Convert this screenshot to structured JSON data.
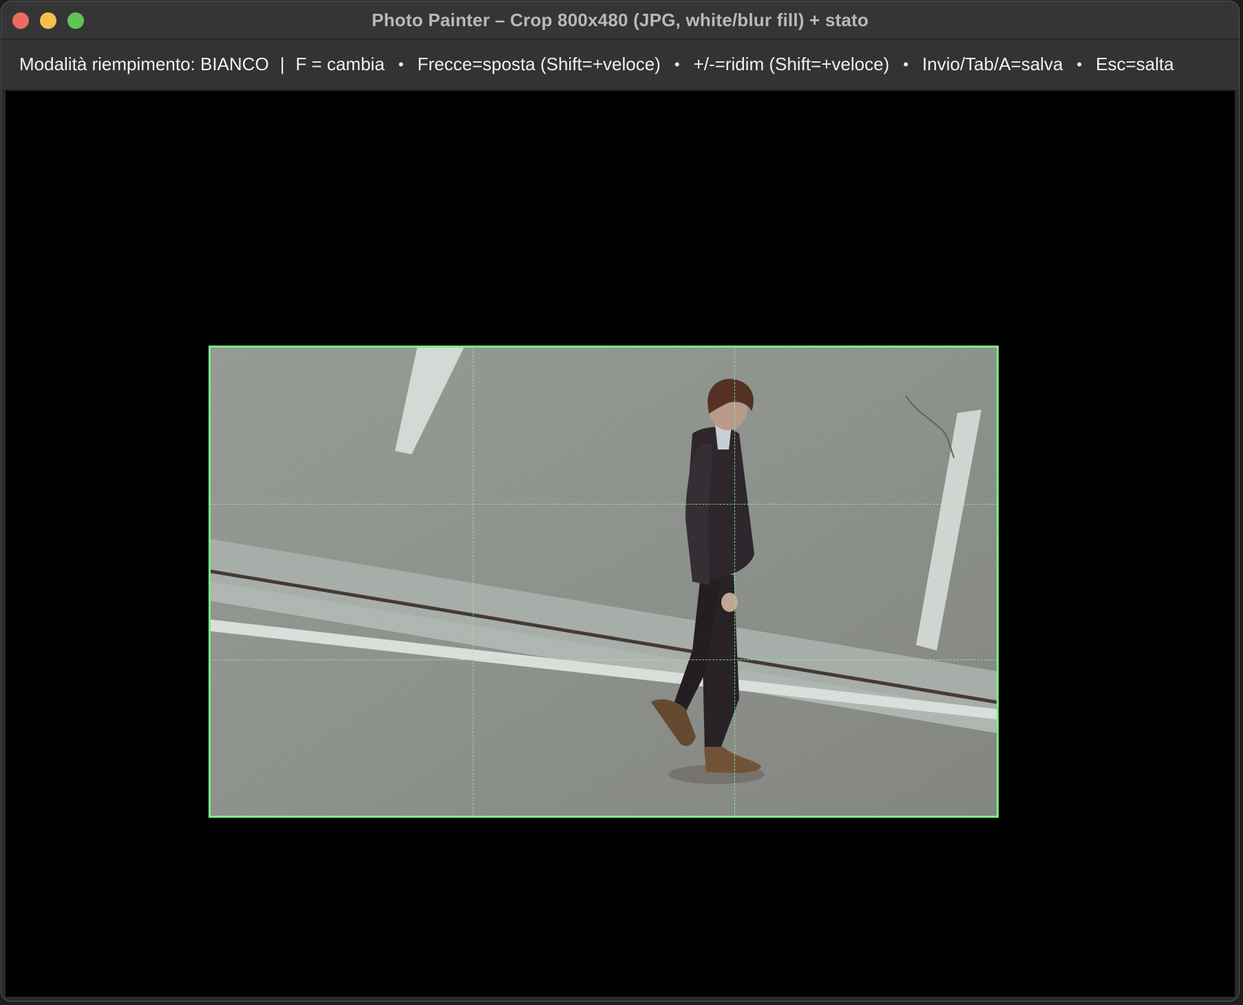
{
  "window": {
    "title": "Photo Painter – Crop 800x480 (JPG, white/blur fill) + stato",
    "controls": {
      "close_color": "#ed6a5e",
      "minimize_color": "#f5bf4f",
      "zoom_color": "#61c554"
    }
  },
  "statusbar": {
    "fill_mode": "Modalità riempimento: BIANCO",
    "separator_pipe": "|",
    "bullet": "•",
    "hints": [
      "F = cambia",
      "Frecce=sposta (Shift=+veloce)",
      "+/-=ridim (Shift=+veloce)",
      "Invio/Tab/A=salva",
      "Esc=salta"
    ]
  },
  "canvas": {
    "background": "#000000",
    "crop_frame_color": "#7cf08c",
    "guides": "rule-of-thirds",
    "photo_subject": "man-walking-on-asphalt-photo"
  }
}
